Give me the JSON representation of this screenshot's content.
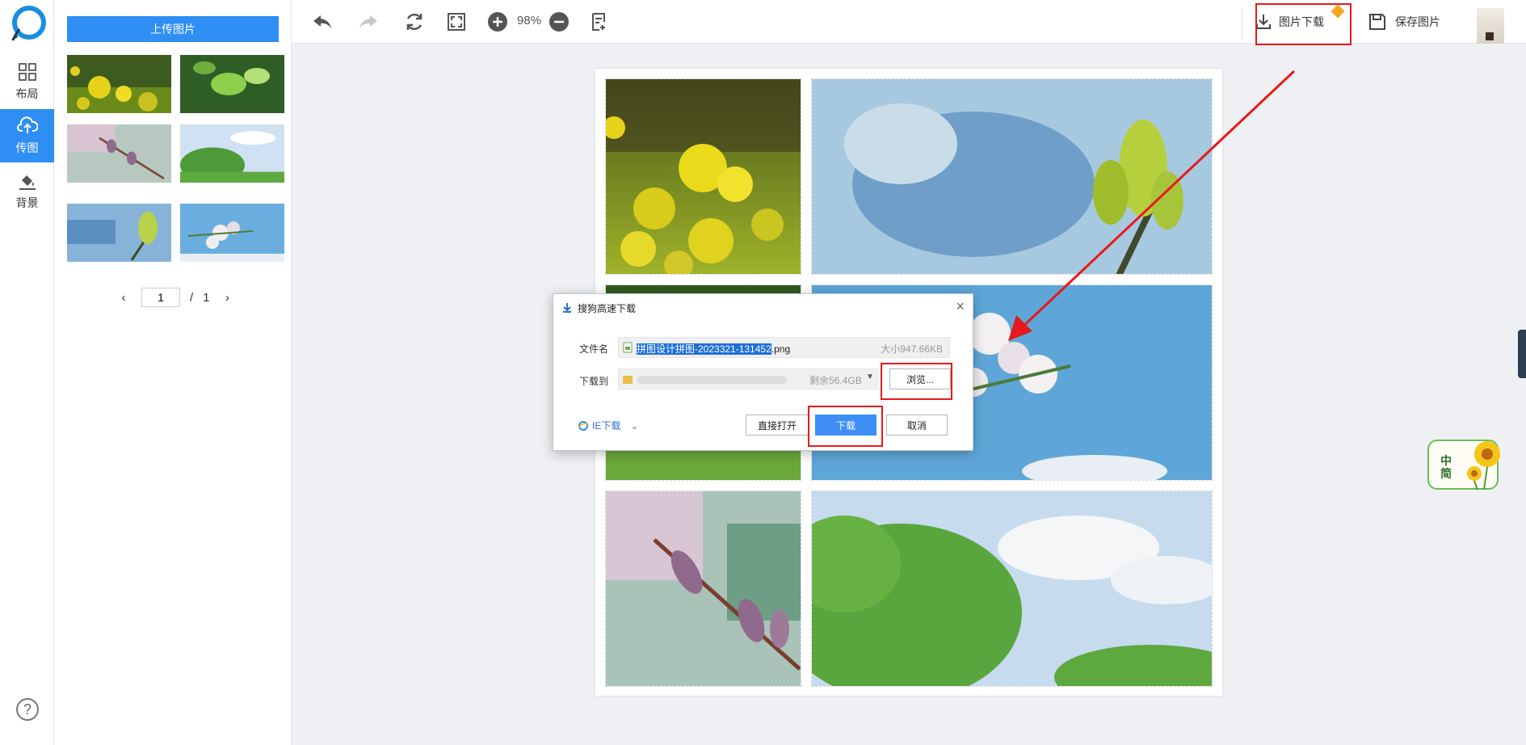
{
  "nav": {
    "items": [
      {
        "label": "布局",
        "icon": "grid-icon"
      },
      {
        "label": "传图",
        "icon": "cloud-upload-icon"
      },
      {
        "label": "背景",
        "icon": "paint-bucket-icon"
      }
    ],
    "help": "?"
  },
  "panel": {
    "upload_label": "上传图片",
    "pager": {
      "current": "1",
      "separator": "/",
      "total": "1"
    }
  },
  "toolbar": {
    "zoom": "98%",
    "download_label": "图片下载",
    "save_label": "保存图片"
  },
  "dialog": {
    "title": "搜狗高速下载",
    "filename_label": "文件名",
    "filename_selected": "拼图设计拼图-2023321-131452",
    "filename_ext": ".png",
    "size": "大小947.66KB",
    "saveto_label": "下载到",
    "free_space": "剩余56.4GB",
    "browse": "浏览...",
    "ie_download": "IE下载",
    "open_direct": "直接打开",
    "download": "下载",
    "cancel": "取消"
  },
  "sticker": {
    "line1": "中",
    "line2": "简"
  },
  "colors": {
    "accent": "#2e8ef3",
    "highlight": "#e8191a"
  }
}
